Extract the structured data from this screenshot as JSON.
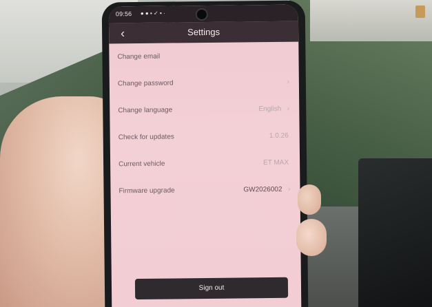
{
  "status_bar": {
    "time": "09:56",
    "icons": "● ● ▪ ✓ ▪ ·"
  },
  "header": {
    "title": "Settings",
    "back_icon": "chevron-left-icon"
  },
  "settings": {
    "items": [
      {
        "label": "Change email",
        "value": "",
        "has_chevron": false
      },
      {
        "label": "Change password",
        "value": "",
        "has_chevron": true
      },
      {
        "label": "Change language",
        "value": "English",
        "has_chevron": true
      },
      {
        "label": "Check for updates",
        "value": "1.0.26",
        "has_chevron": false
      },
      {
        "label": "Current vehicle",
        "value": "ET MAX",
        "has_chevron": false
      },
      {
        "label": "Firmware upgrade",
        "value": "GW2026002",
        "has_chevron": true
      }
    ]
  },
  "footer": {
    "signout_label": "Sign out"
  },
  "colors": {
    "screen_bg": "#f2cdd4",
    "nav_bg": "#3b2f35",
    "button_bg": "#2e2a2d"
  }
}
